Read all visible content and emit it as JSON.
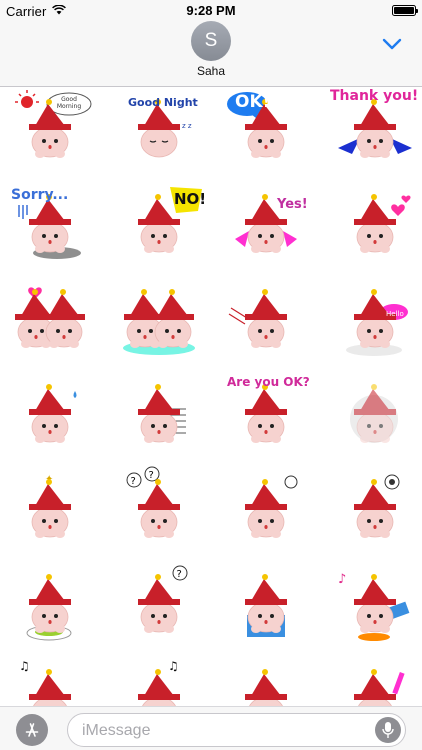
{
  "status_bar": {
    "carrier": "Carrier",
    "time": "9:28 PM"
  },
  "header": {
    "avatar_initial": "S",
    "contact_name": "Saha"
  },
  "stickers": {
    "good_morning": "Good Morning",
    "good_night": "Good Night",
    "ok": "OK!",
    "thank_you": "Thank you!",
    "sorry": "Sorry...",
    "no": "NO!",
    "yes": "Yes!",
    "hello": "Hello",
    "are_you_ok": "Are you OK?"
  },
  "input_bar": {
    "placeholder": "iMessage"
  },
  "colors": {
    "hat": "#c8202a",
    "face": "#f6d2cf",
    "accent": "#1e7cf0"
  }
}
